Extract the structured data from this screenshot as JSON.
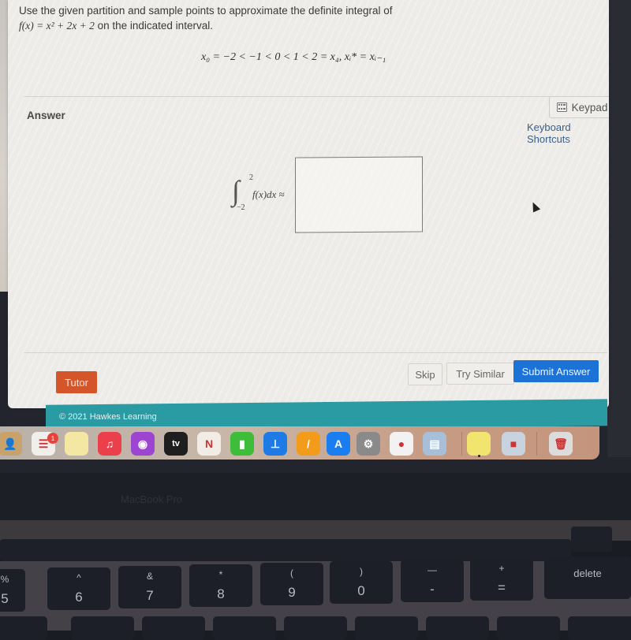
{
  "question": {
    "prompt_line1": "Use the given partition and sample points to approximate the definite integral of",
    "prompt_line2_fx": "f(x) = x² + 2x + 2",
    "prompt_line2_rest": " on the indicated interval.",
    "partition": "x₀ = −2 < −1 < 0 < 1 < 2 = x₄, xᵢ* = xᵢ₋₁"
  },
  "answer": {
    "label": "Answer",
    "keypad_label": "Keypad",
    "keyboard_shortcuts_label": "Keyboard Shortcuts",
    "integral": {
      "sign": "∫",
      "upper": "2",
      "lower": "−2",
      "body": "f(x)dx ≈"
    },
    "input_value": ""
  },
  "actions": {
    "tutor": "Tutor",
    "skip": "Skip",
    "try_similar": "Try Similar",
    "submit": "Submit Answer"
  },
  "footer": {
    "copyright": "© 2021 Hawkes Learning"
  },
  "dock": {
    "items": [
      {
        "name": "contacts",
        "glyph": "👤",
        "color": "#c8a26a"
      },
      {
        "name": "reminders",
        "glyph": "☰",
        "color": "#f1efec",
        "badge": "1"
      },
      {
        "name": "notes",
        "glyph": "",
        "color": "#f3e7a3"
      },
      {
        "name": "music",
        "glyph": "♫",
        "color": "#ec3f4c"
      },
      {
        "name": "podcasts",
        "glyph": "◉",
        "color": "#9b45d1"
      },
      {
        "name": "apple-tv",
        "glyph": "tv",
        "color": "#1e1e1e"
      },
      {
        "name": "news",
        "glyph": "N",
        "color": "#f1ece6"
      },
      {
        "name": "numbers",
        "glyph": "▮",
        "color": "#3dbd3a"
      },
      {
        "name": "keynote",
        "glyph": "⊥",
        "color": "#1e7be6"
      },
      {
        "name": "pages",
        "glyph": "/",
        "color": "#f39c1c"
      },
      {
        "name": "app-store",
        "glyph": "A",
        "color": "#1b7ef0"
      },
      {
        "name": "system-preferences",
        "glyph": "⚙",
        "color": "#8a8a8a"
      },
      {
        "name": "chrome",
        "glyph": "●",
        "color": "#f2f2f2"
      },
      {
        "name": "preview",
        "glyph": "▤",
        "color": "#a8bfd9"
      },
      {
        "name": "stickies",
        "glyph": "",
        "color": "#f1e46f"
      },
      {
        "name": "roblox",
        "glyph": "■",
        "color": "#c9d3df"
      },
      {
        "name": "trash",
        "glyph": "🗑",
        "color": "#dcdcdc"
      }
    ]
  },
  "hardware": {
    "bezel_label": "MacBook Pro",
    "keys": [
      {
        "up": "%",
        "down": "5"
      },
      {
        "up": "^",
        "down": "6"
      },
      {
        "up": "&",
        "down": "7"
      },
      {
        "up": "*",
        "down": "8"
      },
      {
        "up": "(",
        "down": "9"
      },
      {
        "up": ")",
        "down": "0"
      },
      {
        "up": "—",
        "down": "-"
      },
      {
        "up": "+",
        "down": "="
      },
      {
        "up": "",
        "down": "delete"
      }
    ]
  }
}
